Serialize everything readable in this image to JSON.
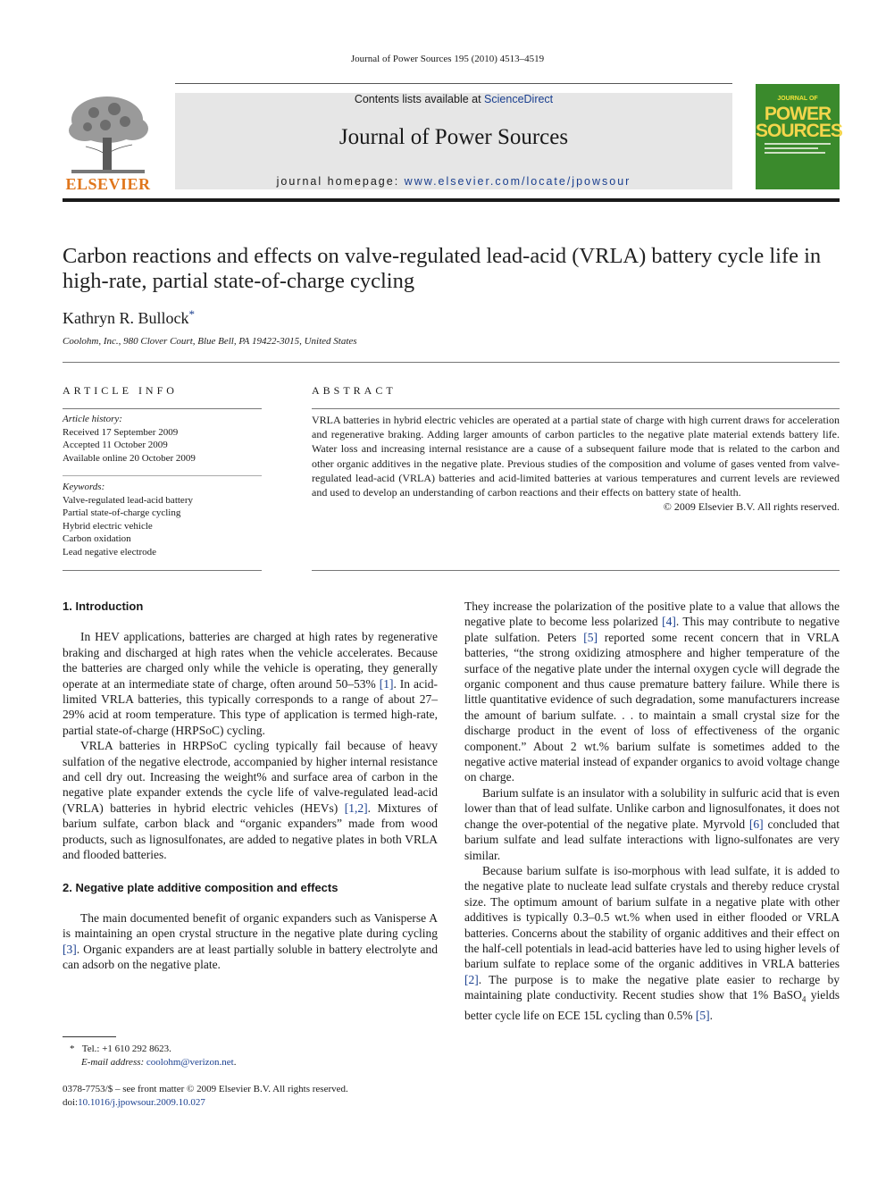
{
  "running_head": "Journal of Power Sources 195 (2010) 4513–4519",
  "header": {
    "contents_prefix": "Contents lists available at ",
    "contents_link": "ScienceDirect",
    "journal_name": "Journal of Power Sources",
    "homepage_prefix": "journal homepage: ",
    "homepage_link": "www.elsevier.com/locate/jpowsour",
    "publisher": "ELSEVIER",
    "cover": {
      "small_top": "JOURNAL OF",
      "big1": "POWER",
      "big2": "SOURCES",
      "accent_color": "#3a8a2c"
    }
  },
  "article": {
    "title": "Carbon reactions and effects on valve-regulated lead-acid (VRLA) battery cycle life in high-rate, partial state-of-charge cycling",
    "author": "Kathryn R. Bullock",
    "author_mark": "*",
    "affiliation": "Coolohm, Inc., 980 Clover Court, Blue Bell, PA 19422-3015, United States"
  },
  "article_info": {
    "heading": "ARTICLE INFO",
    "history_label": "Article history:",
    "history": [
      "Received 17 September 2009",
      "Accepted 11 October 2009",
      "Available online 20 October 2009"
    ],
    "keywords_label": "Keywords:",
    "keywords": [
      "Valve-regulated lead-acid battery",
      "Partial state-of-charge cycling",
      "Hybrid electric vehicle",
      "Carbon oxidation",
      "Lead negative electrode"
    ]
  },
  "abstract": {
    "heading": "ABSTRACT",
    "text": "VRLA batteries in hybrid electric vehicles are operated at a partial state of charge with high current draws for acceleration and regenerative braking. Adding larger amounts of carbon particles to the negative plate material extends battery life. Water loss and increasing internal resistance are a cause of a subsequent failure mode that is related to the carbon and other organic additives in the negative plate. Previous studies of the composition and volume of gases vented from valve-regulated lead-acid (VRLA) batteries and acid-limited batteries at various temperatures and current levels are reviewed and used to develop an understanding of carbon reactions and their effects on battery state of health.",
    "copyright": "© 2009 Elsevier B.V. All rights reserved."
  },
  "body": {
    "sec1_heading": "1.  Introduction",
    "sec1_p1_a": "In HEV applications, batteries are charged at high rates by regenerative braking and discharged at high rates when the vehicle accelerates. Because the batteries are charged only while the vehicle is operating, they generally operate at an intermediate state of charge, often around 50–53% ",
    "sec1_p1_ref1": "[1]",
    "sec1_p1_b": ". In acid-limited VRLA batteries, this typically corresponds to a range of about 27–29% acid at room temperature. This type of application is termed high-rate, partial state-of-charge (HRPSoC) cycling.",
    "sec1_p2_a": "VRLA batteries in HRPSoC cycling typically fail because of heavy sulfation of the negative electrode, accompanied by higher internal resistance and cell dry out. Increasing the weight% and surface area of carbon in the negative plate expander extends the cycle life of valve-regulated lead-acid (VRLA) batteries in hybrid electric vehicles (HEVs) ",
    "sec1_p2_ref": "[1,2]",
    "sec1_p2_b": ". Mixtures of barium sulfate, carbon black and “organic expanders” made from wood products, such as lignosulfonates, are added to negative plates in both VRLA and flooded batteries.",
    "sec2_heading": "2.  Negative plate additive composition and effects",
    "sec2_p1_a": "The main documented benefit of organic expanders such as Vanisperse A is maintaining an open crystal structure in the negative plate during cycling ",
    "sec2_p1_ref": "[3]",
    "sec2_p1_b": ". Organic expanders are at least partially soluble in battery electrolyte and can adsorb on the negative plate.",
    "col2_p1_a": "They increase the polarization of the positive plate to a value that allows the negative plate to become less polarized ",
    "col2_p1_ref1": "[4]",
    "col2_p1_b": ". This may contribute to negative plate sulfation. Peters ",
    "col2_p1_ref2": "[5]",
    "col2_p1_c": " reported some recent concern that in VRLA batteries, “the strong oxidizing atmosphere and higher temperature of the surface of the negative plate under the internal oxygen cycle will degrade the organic component and thus cause premature battery failure. While there is little quantitative evidence of such degradation, some manufacturers increase the amount of barium sulfate. . . to maintain a small crystal size for the discharge product in the event of loss of effectiveness of the organic component.” About 2 wt.% barium sulfate is sometimes added to the negative active material instead of expander organics to avoid voltage change on charge.",
    "col2_p2_a": "Barium sulfate is an insulator with a solubility in sulfuric acid that is even lower than that of lead sulfate. Unlike carbon and lignosulfonates, it does not change the over-potential of the negative plate. Myrvold ",
    "col2_p2_ref": "[6]",
    "col2_p2_b": " concluded that barium sulfate and lead sulfate interactions with ligno-sulfonates are very similar.",
    "col2_p3_a": "Because barium sulfate is iso-morphous with lead sulfate, it is added to the negative plate to nucleate lead sulfate crystals and thereby reduce crystal size. The optimum amount of barium sulfate in a negative plate with other additives is typically 0.3–0.5 wt.% when used in either flooded or VRLA batteries. Concerns about the stability of organic additives and their effect on the half-cell potentials in lead-acid batteries have led to using higher levels of barium sulfate to replace some of the organic additives in VRLA batteries ",
    "col2_p3_ref1": "[2]",
    "col2_p3_b": ". The purpose is to make the negative plate easier to recharge by maintaining plate conductivity. Recent studies show that 1% BaSO",
    "col2_p3_sub": "4",
    "col2_p3_c": " yields better cycle life on ECE 15L cycling than 0.5% ",
    "col2_p3_ref2": "[5]",
    "col2_p3_d": "."
  },
  "footnote": {
    "mark": "*",
    "tel": "Tel.: +1 610 292 8623.",
    "email_label": "E-mail address: ",
    "email": "coolohm@verizon.net",
    "email_end": "."
  },
  "footer": {
    "issn": "0378-7753/$ – see front matter © 2009 Elsevier B.V. All rights reserved.",
    "doi_label": "doi:",
    "doi": "10.1016/j.jpowsour.2009.10.027"
  }
}
